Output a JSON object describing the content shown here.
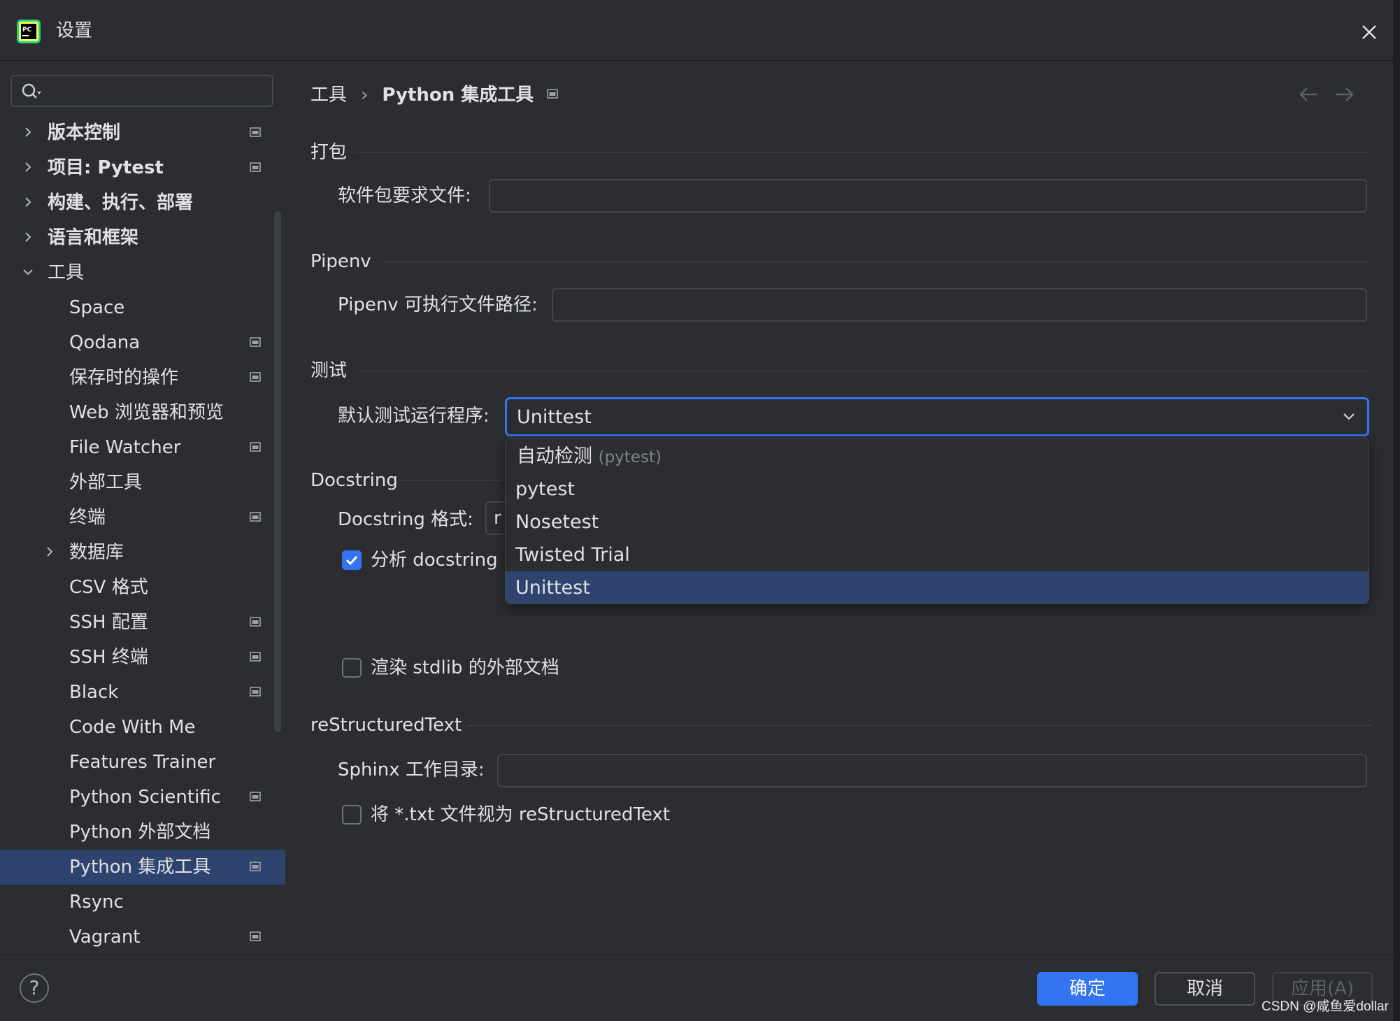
{
  "window": {
    "title": "设置"
  },
  "search": {
    "placeholder": ""
  },
  "sidebar": {
    "items": [
      {
        "label": "版本控制",
        "bold": true
      },
      {
        "label": "项目: Pytest",
        "bold": true
      },
      {
        "label": "构建、执行、部署",
        "bold": true
      },
      {
        "label": "语言和框架",
        "bold": true
      },
      {
        "label": "工具"
      },
      {
        "label": "Space"
      },
      {
        "label": "Qodana"
      },
      {
        "label": "保存时的操作"
      },
      {
        "label": "Web 浏览器和预览"
      },
      {
        "label": "File Watcher"
      },
      {
        "label": "外部工具"
      },
      {
        "label": "终端"
      },
      {
        "label": "数据库"
      },
      {
        "label": "CSV 格式"
      },
      {
        "label": "SSH 配置"
      },
      {
        "label": "SSH 终端"
      },
      {
        "label": "Black"
      },
      {
        "label": "Code With Me"
      },
      {
        "label": "Features Trainer"
      },
      {
        "label": "Python Scientific"
      },
      {
        "label": "Python 外部文档"
      },
      {
        "label": "Python 集成工具",
        "selected": true
      },
      {
        "label": "Rsync"
      },
      {
        "label": "Vagrant"
      }
    ]
  },
  "breadcrumb": {
    "parent": "工具",
    "separator": "›",
    "current": "Python 集成工具"
  },
  "sections": {
    "packaging": {
      "title": "打包",
      "requirements_label": "软件包要求文件:",
      "requirements_value": ""
    },
    "pipenv": {
      "title": "Pipenv",
      "path_label": "Pipenv 可执行文件路径:",
      "path_value": ""
    },
    "testing": {
      "title": "测试",
      "runner_label": "默认测试运行程序:",
      "runner_value": "Unittest"
    },
    "docstring": {
      "title": "Docstring",
      "format_label": "Docstring 格式:",
      "format_value_visible": "r",
      "analyze_label": "分析 docstring 中的类型",
      "analyze_visible": "分析 docstring 中",
      "analyze_checked": true,
      "render_label": "渲染 stdlib 的外部文档",
      "render_checked": false
    },
    "rst": {
      "title": "reStructuredText",
      "sphinx_label": "Sphinx 工作目录:",
      "sphinx_value": "",
      "txt_label": "将 *.txt 文件视为 reStructuredText",
      "txt_checked": false
    }
  },
  "dropdown": {
    "options": [
      {
        "label": "自动检测",
        "hint": "(pytest)"
      },
      {
        "label": "pytest"
      },
      {
        "label": "Nosetest"
      },
      {
        "label": "Twisted Trial"
      },
      {
        "label": "Unittest",
        "selected": true
      }
    ]
  },
  "footer": {
    "help": "?",
    "ok": "确定",
    "cancel": "取消",
    "apply": "应用(A)"
  },
  "watermark": "CSDN @咸鱼爱dollar",
  "colors": {
    "background": "#2b2d30",
    "accent": "#3574f0",
    "selection": "#2e436e",
    "text": "#dfe1e5",
    "muted": "#7f838b"
  },
  "icons": [
    "pycharm-logo-icon",
    "close-icon",
    "search-icon",
    "chevron-right-icon",
    "chevron-down-icon",
    "project-scope-icon",
    "arrow-left-icon",
    "arrow-right-icon",
    "folder-icon",
    "checkmark-icon"
  ]
}
